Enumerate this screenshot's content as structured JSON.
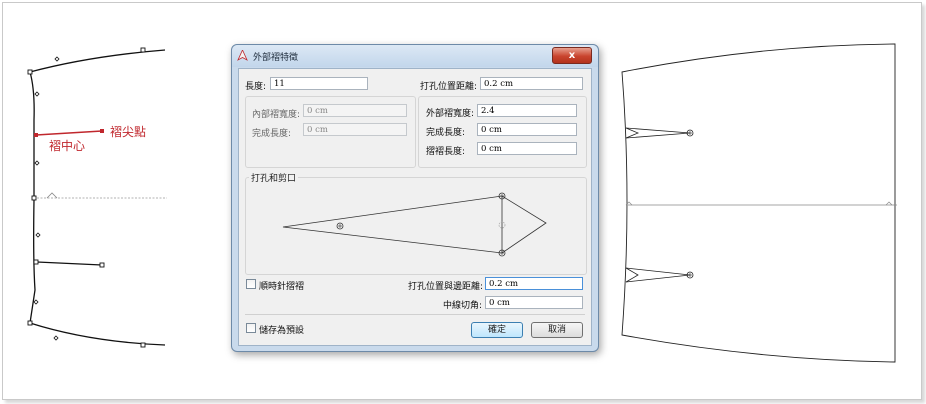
{
  "callouts": {
    "dart_point": "褶尖點",
    "dart_center": "褶中心"
  },
  "dialog": {
    "title": "外部褶特徵",
    "close_glyph": "x",
    "length_label": "長度:",
    "length_value": "11",
    "punch_distance_label": "打孔位置距離:",
    "punch_distance_value": "0.2 cm",
    "inner_width_label": "內部褶寬度:",
    "inner_width_value": "0 cm",
    "inner_finish_label": "完成長度:",
    "inner_finish_value": "0 cm",
    "outer_width_label": "外部褶寬度:",
    "outer_width_value": "2.4",
    "outer_finish_label": "完成長度:",
    "outer_finish_value": "0 cm",
    "fold_length_label": "摺褶長度:",
    "fold_length_value": "0 cm",
    "group_label": "打孔和剪口",
    "clockwise_label": "順時針摺褶",
    "punch_edge_label": "打孔位置與邊距離:",
    "punch_edge_value": "0.2 cm",
    "center_cut_label": "中線切角:",
    "center_cut_value": "0 cm",
    "save_default_label": "儲存為預設",
    "ok_label": "確定",
    "cancel_label": "取消"
  }
}
